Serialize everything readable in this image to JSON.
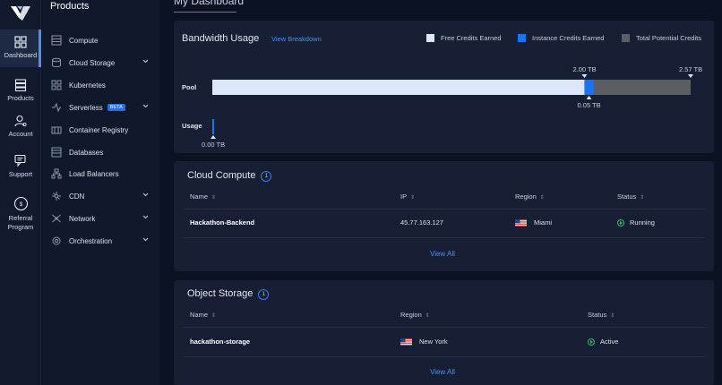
{
  "rail": {
    "items": [
      {
        "label": "Dashboard",
        "icon": "dashboard-grid-icon"
      },
      {
        "label": "Products",
        "icon": "products-server-icon"
      },
      {
        "label": "Account",
        "icon": "account-user-icon"
      },
      {
        "label": "Support",
        "icon": "support-chat-icon"
      },
      {
        "label_line1": "Referral",
        "label_line2": "Program",
        "icon": "referral-icon"
      }
    ]
  },
  "products": {
    "title": "Products",
    "items": [
      {
        "label": "Compute"
      },
      {
        "label": "Cloud Storage"
      },
      {
        "label": "Kubernetes"
      },
      {
        "label": "Serverless",
        "badge": "BETA"
      },
      {
        "label": "Container Registry"
      },
      {
        "label": "Databases"
      },
      {
        "label": "Load Balancers"
      },
      {
        "label": "CDN"
      },
      {
        "label": "Network"
      },
      {
        "label": "Orchestration"
      }
    ]
  },
  "dashboard": {
    "title": "My Dashboard"
  },
  "bandwidth": {
    "title": "Bandwidth Usage",
    "link": "View Breakdown",
    "legend": [
      {
        "label": "Free Credits Earned",
        "color": "#dde7fb"
      },
      {
        "label": "Instance Credits Earned",
        "color": "#1a73f0"
      },
      {
        "label": "Total Potential Credits",
        "color": "#5b5e63"
      }
    ],
    "pool_label": "Pool",
    "usage_label": "Usage",
    "free_tb": "2.00 TB",
    "instance_tb": "0.05 TB",
    "total_tb": "2.57 TB",
    "usage_tb": "0.00 TB",
    "pool_free_fraction": 0.778,
    "pool_instance_fraction": 0.019,
    "usage_fraction": 0.0
  },
  "compute": {
    "title": "Cloud Compute",
    "count": "1",
    "headers": {
      "name": "Name",
      "ip": "IP",
      "region": "Region",
      "status": "Status"
    },
    "row": {
      "name": "Hackathon-Backend",
      "ip": "45.77.163.127",
      "region": "Miami",
      "status": "Running"
    },
    "view_all": "View All"
  },
  "storage": {
    "title": "Object Storage",
    "count": "1",
    "headers": {
      "name": "Name",
      "region": "Region",
      "status": "Status"
    },
    "row": {
      "name": "hackathon-storage",
      "region": "New York",
      "status": "Active"
    },
    "view_all": "View All"
  }
}
